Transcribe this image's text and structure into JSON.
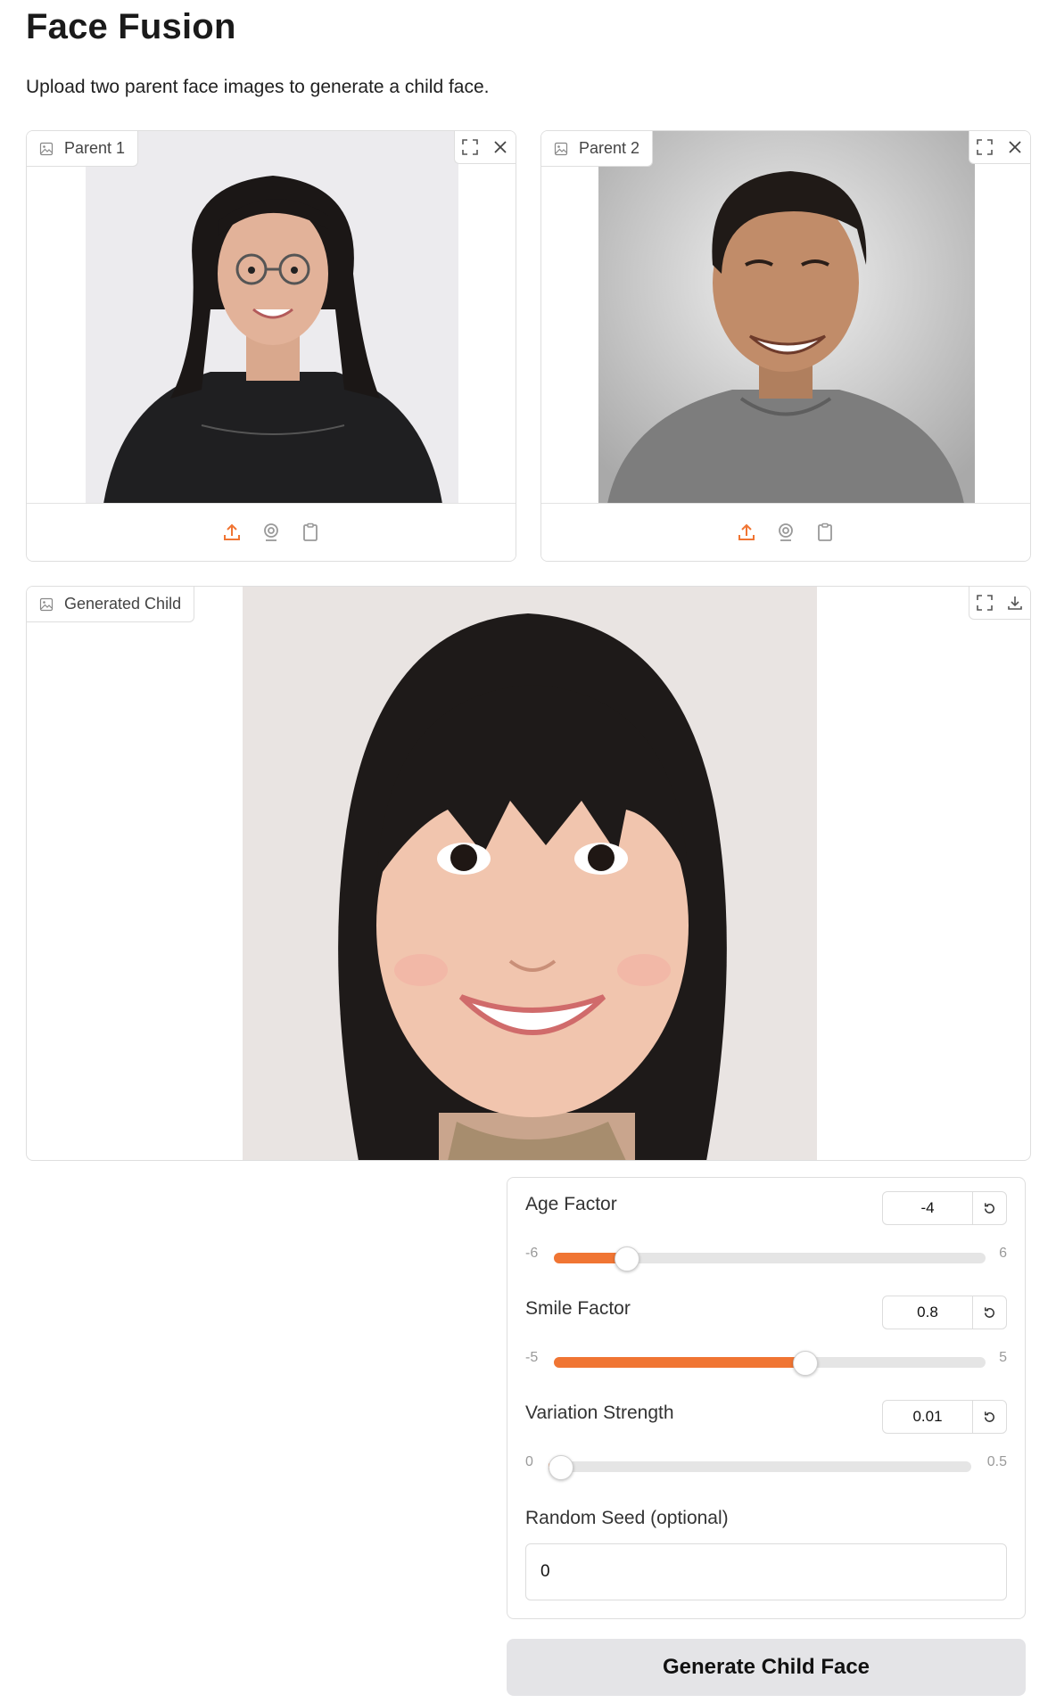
{
  "page": {
    "title": "Face Fusion",
    "description": "Upload two parent face images to generate a child face."
  },
  "parent1": {
    "label": "Parent 1"
  },
  "parent2": {
    "label": "Parent 2"
  },
  "child": {
    "label": "Generated Child"
  },
  "icons": {
    "image": "image-icon",
    "fullscreen": "fullscreen-icon",
    "close": "close-icon",
    "download": "download-icon",
    "upload": "upload-icon",
    "webcam": "webcam-icon",
    "clipboard": "clipboard-icon",
    "reset": "reset-icon"
  },
  "colors": {
    "accent": "#f07533",
    "button_bg": "#e4e4e7"
  },
  "controls": {
    "age": {
      "label": "Age Factor",
      "value": "-4",
      "min": "-6",
      "max": "6",
      "fraction": 0.1667
    },
    "smile": {
      "label": "Smile Factor",
      "value": "0.8",
      "min": "-5",
      "max": "5",
      "fraction": 0.58
    },
    "variation": {
      "label": "Variation Strength",
      "value": "0.01",
      "min": "0",
      "max": "0.5",
      "fraction": 0.02
    },
    "seed": {
      "label": "Random Seed (optional)",
      "value": "0"
    }
  },
  "generate_button": {
    "label": "Generate Child Face"
  }
}
